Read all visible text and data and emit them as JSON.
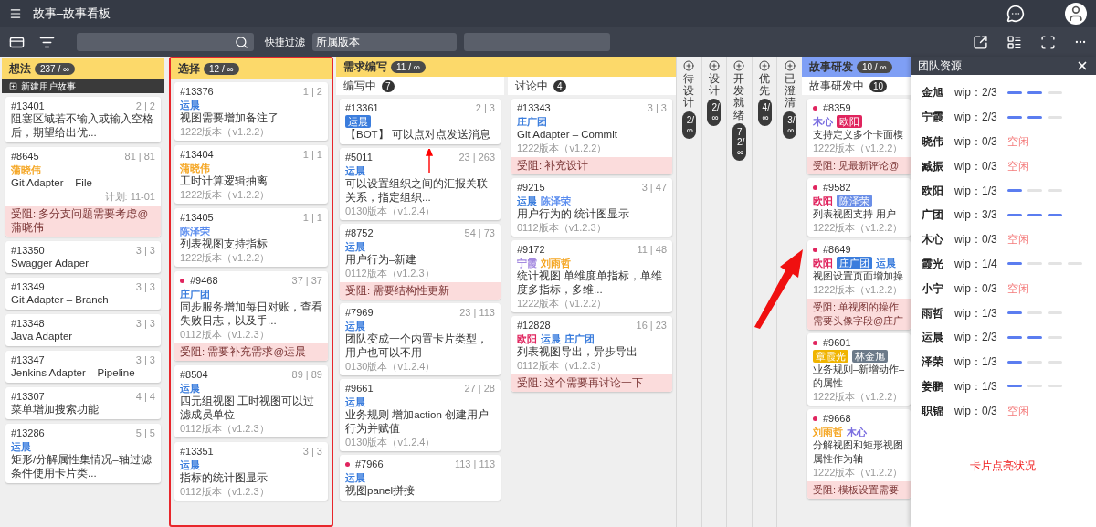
{
  "window": {
    "title": "故事–故事看板"
  },
  "toolbar": {
    "quick_filter_label": "快捷过滤",
    "filter_value": "所属版本"
  },
  "board": {
    "columns": [
      {
        "kind": "list",
        "title": "想法",
        "count": "237 / ∞",
        "color": "#fcd96a",
        "new_label": "新建用户故事",
        "cards": [
          {
            "id": "#13401",
            "counts": "2 | 2",
            "flagged": false,
            "title": "阻塞区域若不输入或输入空格后，期望给出优..."
          },
          {
            "id": "#8645",
            "counts": "81 | 81",
            "flagged": false,
            "tags": [
              {
                "name": "蒲晓伟",
                "color": "#f5a623",
                "filled": false
              }
            ],
            "title": "Git Adapter – File",
            "plan": "计划: 11-01",
            "blocked": "受阻: 多分支问题需要考虑@蒲晓伟"
          },
          {
            "id": "#13350",
            "counts": "3 | 3",
            "flagged": false,
            "title": "Swagger Adaper"
          },
          {
            "id": "#13349",
            "counts": "3 | 3",
            "flagged": false,
            "title": "Git Adapter – Branch"
          },
          {
            "id": "#13348",
            "counts": "3 | 3",
            "flagged": false,
            "title": "Java Adapter"
          },
          {
            "id": "#13347",
            "counts": "3 | 3",
            "flagged": false,
            "title": "Jenkins Adapter – Pipeline"
          },
          {
            "id": "#13307",
            "counts": "4 | 4",
            "flagged": false,
            "title": "菜单增加搜索功能"
          },
          {
            "id": "#13286",
            "counts": "5 | 5",
            "flagged": false,
            "tags": [
              {
                "name": "运晨",
                "color": "#3b7ddd",
                "filled": false
              }
            ],
            "title": "矩形/分解属性集情况–轴过滤条件使用卡片类..."
          }
        ]
      },
      {
        "kind": "list",
        "title": "选择",
        "count": "12 / ∞",
        "color": "#fcd96a",
        "outlined": true,
        "cards": [
          {
            "id": "#13376",
            "counts": "1 | 2",
            "flagged": false,
            "tags": [
              {
                "name": "运晨",
                "color": "#3b7ddd",
                "filled": false
              }
            ],
            "title": "视图需要增加备注了",
            "version": "1222版本（v1.2.2）"
          },
          {
            "id": "#13404",
            "counts": "1 | 1",
            "flagged": false,
            "tags": [
              {
                "name": "蒲晓伟",
                "color": "#f5a623",
                "filled": false
              }
            ],
            "title": "工时计算逻辑抽离",
            "version": "1222版本（v1.2.2）"
          },
          {
            "id": "#13405",
            "counts": "1 | 1",
            "flagged": false,
            "tags": [
              {
                "name": "陈泽荣",
                "color": "#5b8def",
                "filled": false
              }
            ],
            "title": "列表视图支持指标",
            "version": "1222版本（v1.2.2）"
          },
          {
            "id": "#9468",
            "counts": "37 | 37",
            "flagged": true,
            "tags": [
              {
                "name": "庄广团",
                "color": "#3b7ddd",
                "filled": false
              }
            ],
            "title": "同步服务增加每日对账，查看失败日志，以及手...",
            "version": "0112版本（v1.2.3）",
            "blocked": "受阻: 需要补充需求@运晨"
          },
          {
            "id": "#8504",
            "counts": "89 | 89",
            "flagged": false,
            "tags": [
              {
                "name": "运晨",
                "color": "#3b7ddd",
                "filled": false
              }
            ],
            "title": "四元组视图 工时视图可以过滤成员单位",
            "version": "0112版本（v1.2.3）"
          },
          {
            "id": "#13351",
            "counts": "3 | 3",
            "flagged": false,
            "tags": [
              {
                "name": "运晨",
                "color": "#3b7ddd",
                "filled": false
              }
            ],
            "title": "指标的统计图显示",
            "version": "0112版本（v1.2.3）"
          }
        ]
      },
      {
        "kind": "group",
        "title": "需求编写",
        "count": "11 / ∞",
        "color": "#fcd96a",
        "subcolumns": [
          {
            "title": "编写中",
            "count": "7",
            "cards": [
              {
                "id": "#13361",
                "counts": "2 | 3",
                "flagged": false,
                "tags": [
                  {
                    "name": "运晨",
                    "color": "#3b7ddd",
                    "filled": true
                  }
                ],
                "title": "【BOT】 可以点对点发送消息"
              },
              {
                "id": "#5011",
                "counts": "23 | 263",
                "flagged": false,
                "tags": [
                  {
                    "name": "运晨",
                    "color": "#3b7ddd",
                    "filled": false
                  }
                ],
                "title": "可以设置组织之间的汇报关联关系，指定组织...",
                "version": "0130版本（v1.2.4）"
              },
              {
                "id": "#8752",
                "counts": "54 | 73",
                "flagged": false,
                "tags": [
                  {
                    "name": "运晨",
                    "color": "#3b7ddd",
                    "filled": false
                  }
                ],
                "title": "用户行为–新建",
                "version": "0112版本（v1.2.3）",
                "blocked": "受阻: 需要结构性更新"
              },
              {
                "id": "#7969",
                "counts": "23 | 113",
                "flagged": false,
                "tags": [
                  {
                    "name": "运晨",
                    "color": "#3b7ddd",
                    "filled": false
                  }
                ],
                "title": "团队变成一个内置卡片类型，用户也可以不用",
                "version": "0130版本（v1.2.4）"
              },
              {
                "id": "#9661",
                "counts": "27 | 28",
                "flagged": false,
                "tags": [
                  {
                    "name": "运晨",
                    "color": "#3b7ddd",
                    "filled": false
                  }
                ],
                "title": "业务规则 增加action 创建用户行为并赋值",
                "version": "0130版本（v1.2.4）"
              },
              {
                "id": "#7966",
                "counts": "113 | 113",
                "flagged": true,
                "tags": [
                  {
                    "name": "运晨",
                    "color": "#3b7ddd",
                    "filled": false
                  }
                ],
                "title": "视图panel拼接"
              }
            ]
          },
          {
            "title": "讨论中",
            "count": "4",
            "cards": [
              {
                "id": "#13343",
                "counts": "3 | 3",
                "flagged": false,
                "tags": [
                  {
                    "name": "庄广团",
                    "color": "#3b7ddd",
                    "filled": false
                  }
                ],
                "title": "Git Adapter – Commit",
                "version": "1222版本（v1.2.2）",
                "blocked": "受阻: 补充设计"
              },
              {
                "id": "#9215",
                "counts": "3 | 47",
                "flagged": false,
                "tags": [
                  {
                    "name": "运晨",
                    "color": "#3b7ddd",
                    "filled": false
                  },
                  {
                    "name": "陈泽荣",
                    "color": "#5b8def",
                    "filled": false
                  }
                ],
                "title": "用户行为的 统计图显示",
                "version": "0112版本（v1.2.3）"
              },
              {
                "id": "#9172",
                "counts": "11 | 48",
                "flagged": false,
                "tags": [
                  {
                    "name": "宁霞",
                    "color": "#a58be0",
                    "filled": false
                  },
                  {
                    "name": "刘雨哲",
                    "color": "#f5a623",
                    "filled": false
                  }
                ],
                "title": "统计视图 单维度单指标，单维度多指标，多维...",
                "version": "1222版本（v1.2.2）"
              },
              {
                "id": "#12828",
                "counts": "16 | 23",
                "flagged": false,
                "tags": [
                  {
                    "name": "欧阳",
                    "color": "#e0245e",
                    "filled": false
                  },
                  {
                    "name": "运晨",
                    "color": "#3b7ddd",
                    "filled": false
                  },
                  {
                    "name": "庄广团",
                    "color": "#3b7ddd",
                    "filled": false
                  }
                ],
                "title": "列表视图导出，异步导出",
                "version": "0112版本（v1.2.3）",
                "blocked": "受阻: 这个需要再讨论一下"
              }
            ]
          }
        ]
      },
      {
        "kind": "collapsed",
        "title": "待设计",
        "count": "2/∞"
      },
      {
        "kind": "collapsed",
        "title": "设计",
        "count": "2/∞"
      },
      {
        "kind": "collapsed",
        "title": "开发就绪",
        "count": "72/∞"
      },
      {
        "kind": "collapsed",
        "title": "优先",
        "count": "4/∞"
      },
      {
        "kind": "collapsed",
        "title": "已澄清",
        "count": "3/∞"
      },
      {
        "kind": "group",
        "title": "故事研发",
        "count": "10 / ∞",
        "color": "#7f9ff5",
        "subcolumns": [
          {
            "title": "故事研发中",
            "count": "10",
            "cards": [
              {
                "id": "#8359",
                "flagged": true,
                "tags": [
                  {
                    "name": "木心",
                    "color": "#7b6fe0",
                    "filled": false
                  },
                  {
                    "name": "欧阳",
                    "color": "#e0245e",
                    "filled": true
                  }
                ],
                "title": "支持定义多个卡面模",
                "version": "1222版本（v1.2.2）",
                "blocked": "受阻: 见最新评论@"
              },
              {
                "id": "#9582",
                "flagged": true,
                "tags": [
                  {
                    "name": "欧阳",
                    "color": "#e0245e",
                    "filled": false
                  },
                  {
                    "name": "陈泽荣",
                    "color": "#6b8fe8",
                    "filled": true
                  }
                ],
                "title": "列表视图支持 用户",
                "version": "1222版本（v1.2.2）"
              },
              {
                "id": "#8649",
                "flagged": true,
                "tags": [
                  {
                    "name": "欧阳",
                    "color": "#e0245e",
                    "filled": false
                  },
                  {
                    "name": "庄广团",
                    "color": "#3b7ddd",
                    "filled": true
                  },
                  {
                    "name": "运晨",
                    "color": "#3b7ddd",
                    "filled": false
                  }
                ],
                "title": "视图设置页面增加操",
                "version": "1222版本（v1.2.2）",
                "blocked": "受阻: 单视图的操作需要头像字段@庄广"
              },
              {
                "id": "#9601",
                "flagged": true,
                "tags": [
                  {
                    "name": "章霞光",
                    "color": "#f0b400",
                    "filled": true
                  },
                  {
                    "name": "林金旭",
                    "color": "#6c7a89",
                    "filled": true
                  }
                ],
                "title": "业务规则–新增动作–的属性",
                "version": "1222版本（v1.2.2）"
              },
              {
                "id": "#9668",
                "flagged": true,
                "tags": [
                  {
                    "name": "刘雨哲",
                    "color": "#f5a623",
                    "filled": false
                  },
                  {
                    "name": "木心",
                    "color": "#7b6fe0",
                    "filled": false
                  }
                ],
                "title": "分解视图和矩形视图属性作为轴",
                "version": "1222版本（v1.2.2）",
                "blocked": "受阻: 模板设置需要"
              }
            ]
          }
        ]
      }
    ]
  },
  "team_panel": {
    "title": "团队资源",
    "footer_note": "卡片点亮状况",
    "members": [
      {
        "name": "金旭",
        "wip": "wip：2/3",
        "kind": "bars",
        "segments": [
          true,
          true,
          false
        ]
      },
      {
        "name": "宁霞",
        "wip": "wip：2/3",
        "kind": "bars",
        "segments": [
          true,
          true,
          false
        ]
      },
      {
        "name": "晓伟",
        "wip": "wip：0/3",
        "kind": "idle",
        "status": "空闲"
      },
      {
        "name": "臧振",
        "wip": "wip：0/3",
        "kind": "idle",
        "status": "空闲"
      },
      {
        "name": "欧阳",
        "wip": "wip：1/3",
        "kind": "bars",
        "segments": [
          true,
          false,
          false
        ]
      },
      {
        "name": "广团",
        "wip": "wip：3/3",
        "kind": "bars",
        "segments": [
          true,
          true,
          true
        ]
      },
      {
        "name": "木心",
        "wip": "wip：0/3",
        "kind": "idle",
        "status": "空闲"
      },
      {
        "name": "霞光",
        "wip": "wip：1/4",
        "kind": "bars",
        "segments": [
          true,
          false,
          false,
          false
        ]
      },
      {
        "name": "小宁",
        "wip": "wip：0/3",
        "kind": "idle",
        "status": "空闲"
      },
      {
        "name": "雨哲",
        "wip": "wip：1/3",
        "kind": "bars",
        "segments": [
          true,
          false,
          false
        ]
      },
      {
        "name": "运晨",
        "wip": "wip：2/3",
        "kind": "bars",
        "segments": [
          true,
          true,
          false
        ]
      },
      {
        "name": "泽荣",
        "wip": "wip：1/3",
        "kind": "bars",
        "segments": [
          true,
          false,
          false
        ]
      },
      {
        "name": "姜鹏",
        "wip": "wip：1/3",
        "kind": "bars",
        "segments": [
          true,
          false,
          false
        ]
      },
      {
        "name": "职锦",
        "wip": "wip：0/3",
        "kind": "idle",
        "status": "空闲"
      }
    ]
  }
}
